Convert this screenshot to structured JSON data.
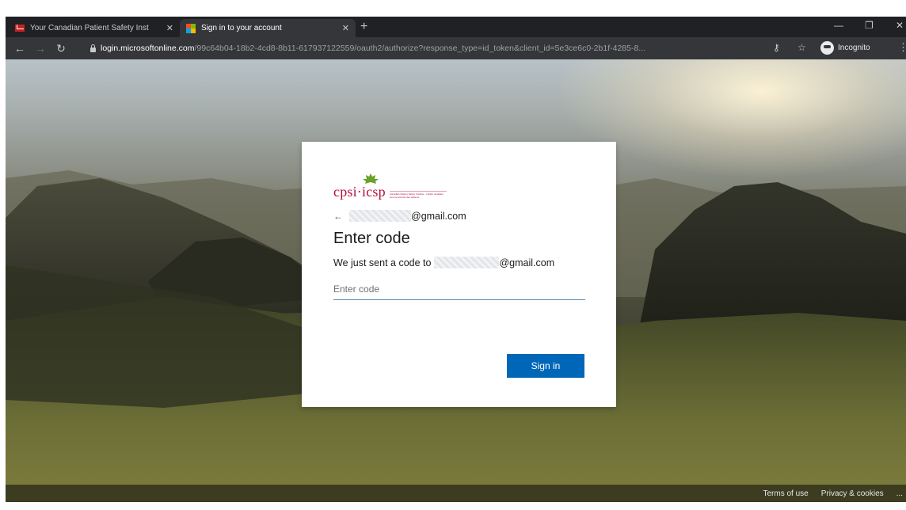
{
  "browser": {
    "tabs": [
      {
        "title": "Your Canadian Patient Safety Inst",
        "favicon": "gmail-icon",
        "active": false
      },
      {
        "title": "Sign in to your account",
        "favicon": "microsoft-icon",
        "active": true
      }
    ],
    "new_tab": "+",
    "window_controls": {
      "minimize": "—",
      "restore": "❐",
      "close": "✕"
    },
    "url_host": "login.microsoftonline.com",
    "url_path": "/99c64b04-18b2-4cd8-8b11-617937122559/oauth2/authorize?response_type=id_token&client_id=5e3ce6c0-2b1f-4285-8...",
    "incognito_label": "Incognito"
  },
  "card": {
    "logo_text": "cpsi·icsp",
    "logo_tagline": "Canadian Patient Safety Institute · Institut canadien pour la sécurité des patients",
    "account_suffix": "@gmail.com",
    "title": "Enter code",
    "desc_prefix": "We just sent a code to",
    "desc_suffix": "@gmail.com",
    "code_placeholder": "Enter code",
    "signin_label": "Sign in",
    "accent_color": "#0067b8"
  },
  "footer": {
    "terms": "Terms of use",
    "privacy": "Privacy & cookies",
    "more": "..."
  }
}
